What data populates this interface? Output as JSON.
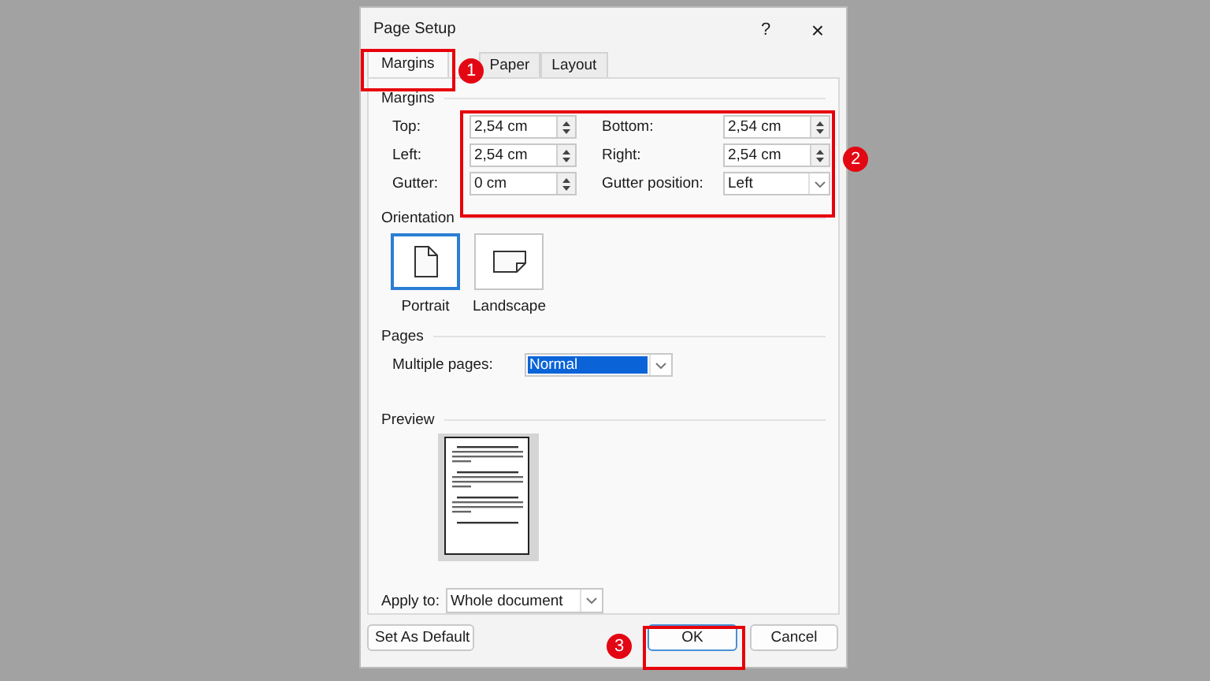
{
  "window": {
    "title": "Page Setup",
    "help_button": "?",
    "close_button": "×"
  },
  "tabs": [
    {
      "label": "Margins",
      "selected": true
    },
    {
      "label": "Paper",
      "selected": false
    },
    {
      "label": "Layout",
      "selected": false
    }
  ],
  "margins": {
    "heading": "Margins",
    "fields": [
      {
        "label": "Top:",
        "value": "2,54 cm",
        "kind": "spin"
      },
      {
        "label": "Bottom:",
        "value": "2,54 cm",
        "kind": "spin"
      },
      {
        "label": "Left:",
        "value": "2,54 cm",
        "kind": "spin"
      },
      {
        "label": "Right:",
        "value": "2,54 cm",
        "kind": "spin"
      },
      {
        "label": "Gutter:",
        "value": "0 cm",
        "kind": "spin"
      },
      {
        "label": "Gutter position:",
        "value": "Left",
        "kind": "dropdown"
      }
    ]
  },
  "orientation": {
    "heading": "Orientation",
    "options": [
      {
        "label": "Portrait",
        "kind": "portrait",
        "selected": true
      },
      {
        "label": "Landscape",
        "kind": "landscape",
        "selected": false
      }
    ]
  },
  "pages": {
    "heading": "Pages",
    "multiple_pages": {
      "label": "Multiple pages:",
      "value": "Normal"
    }
  },
  "preview": {
    "heading": "Preview",
    "apply_to": {
      "label": "Apply to:",
      "value": "Whole document"
    }
  },
  "buttons": [
    {
      "label": "Set As Default",
      "kind": "secondary"
    },
    {
      "label": "OK",
      "kind": "default"
    },
    {
      "label": "Cancel",
      "kind": "secondary"
    }
  ],
  "annotations": [
    {
      "label": "1",
      "kind": "tab"
    },
    {
      "label": "2",
      "kind": "fields"
    },
    {
      "label": "3",
      "kind": "button"
    }
  ]
}
